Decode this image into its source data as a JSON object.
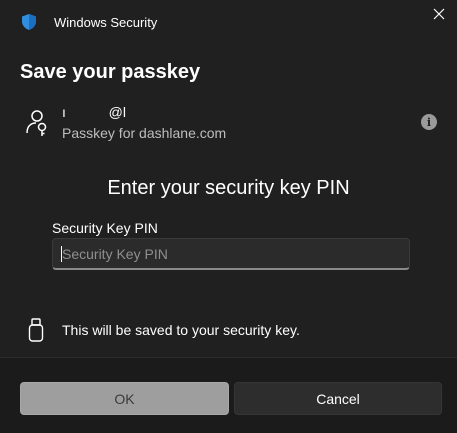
{
  "window": {
    "app_title": "Windows Security",
    "app_icon": "shield-icon",
    "close_icon": "close-icon"
  },
  "dialog": {
    "heading": "Save your passkey",
    "account": {
      "user": "ı           @l",
      "subtitle": "Passkey for dashlane.com",
      "icon": "person-key-icon",
      "info_icon": "info-icon"
    },
    "pin_heading": "Enter your security key PIN",
    "pin_field": {
      "label": "Security Key PIN",
      "placeholder": "Security Key PIN",
      "value": ""
    },
    "note": {
      "icon": "usb-key-icon",
      "text": "This will be saved to your security key."
    }
  },
  "footer": {
    "ok_label": "OK",
    "cancel_label": "Cancel"
  },
  "colors": {
    "background": "#202020",
    "footer_background": "#1b1b1b",
    "shield": "#2f8ee0",
    "ok_button": "#9e9e9e",
    "cancel_button": "#2d2d2d"
  }
}
